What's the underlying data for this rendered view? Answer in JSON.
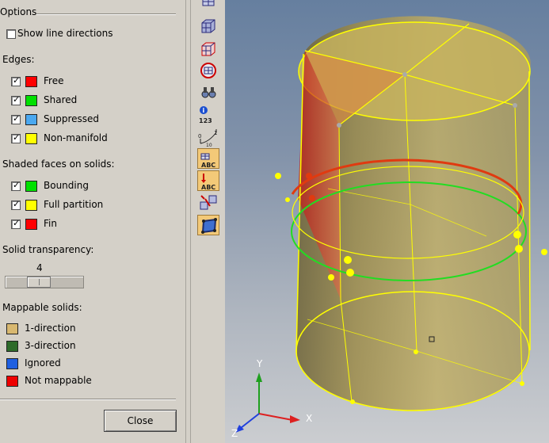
{
  "panel": {
    "title": "Options",
    "show_line_directions": {
      "label": "Show line directions",
      "checked": false
    },
    "edges": {
      "heading": "Edges:",
      "items": [
        {
          "label": "Free",
          "checked": true,
          "color": "#ff0000"
        },
        {
          "label": "Shared",
          "checked": true,
          "color": "#00e000"
        },
        {
          "label": "Suppressed",
          "checked": true,
          "color": "#4aa8f0"
        },
        {
          "label": "Non-manifold",
          "checked": true,
          "color": "#ffff00"
        }
      ]
    },
    "shaded_faces": {
      "heading": "Shaded faces on solids:",
      "items": [
        {
          "label": "Bounding",
          "checked": true,
          "color": "#00e000"
        },
        {
          "label": "Full partition",
          "checked": true,
          "color": "#ffff00"
        },
        {
          "label": "Fin",
          "checked": true,
          "color": "#ff0000"
        }
      ]
    },
    "solid_transparency": {
      "heading": "Solid transparency:",
      "value": "4",
      "level": 4
    },
    "mappable": {
      "heading": "Mappable solids:",
      "items": [
        {
          "label": "1-direction",
          "color": "#d8b870"
        },
        {
          "label": "3-direction",
          "color": "#2e6b2a"
        },
        {
          "label": "Ignored",
          "color": "#1f5fe0"
        },
        {
          "label": "Not mappable",
          "color": "#ee0000"
        }
      ]
    },
    "close_label": "Close"
  },
  "toolbar": {
    "items": [
      {
        "icon": "mesh-cube-icon",
        "active": false
      },
      {
        "icon": "mesh-cube-shaded-icon",
        "active": false
      },
      {
        "icon": "mesh-cube-red-icon",
        "active": false
      },
      {
        "icon": "target-mesh-icon",
        "active": false
      },
      {
        "icon": "binoculars-icon",
        "active": false
      },
      {
        "icon": "info-numbering-icon",
        "active": false,
        "text": "123"
      },
      {
        "icon": "scale-ruler-icon",
        "active": false,
        "text_a": "0",
        "text_b": "1",
        "text_c": "10"
      },
      {
        "icon": "label-abc-icon",
        "active": true,
        "text": "ABC"
      },
      {
        "icon": "label-abc-arrow-icon",
        "active": true,
        "text": "ABC"
      },
      {
        "icon": "move-cubes-icon",
        "active": false
      },
      {
        "icon": "surface-select-icon",
        "active": true
      }
    ]
  },
  "viewport": {
    "triad": {
      "x_label": "X",
      "y_label": "Y",
      "z_label": "Z"
    }
  }
}
